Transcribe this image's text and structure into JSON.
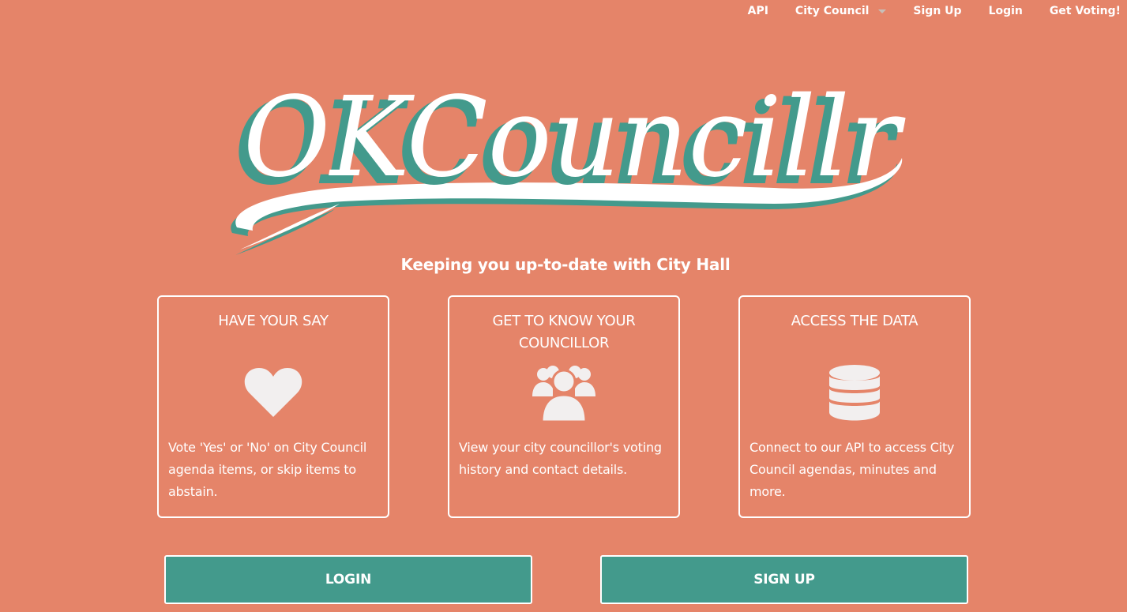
{
  "nav": {
    "items": [
      {
        "label": "API"
      },
      {
        "label": "City Council",
        "dropdown": true
      },
      {
        "label": "Sign Up"
      },
      {
        "label": "Login"
      },
      {
        "label": "Get Voting!"
      }
    ]
  },
  "logo": {
    "text": "OKCouncillr"
  },
  "tagline": "Keeping you up-to-date with City Hall",
  "cards": [
    {
      "title": "HAVE YOUR SAY",
      "icon": "heart-icon",
      "text": "Vote 'Yes' or 'No' on City Council agenda items, or skip items to abstain."
    },
    {
      "title": "GET TO KNOW YOUR COUNCILLOR",
      "icon": "users-icon",
      "text": "View your city councillor's voting history and contact details."
    },
    {
      "title": "ACCESS THE DATA",
      "icon": "database-icon",
      "text": "Connect to our API to access City Council agendas, minutes and more."
    }
  ],
  "buttons": {
    "login": "LOGIN",
    "signup": "SIGN UP"
  },
  "colors": {
    "background": "#e58469",
    "accent": "#439a8c",
    "text": "#ffffff",
    "icon": "#f2efef"
  }
}
